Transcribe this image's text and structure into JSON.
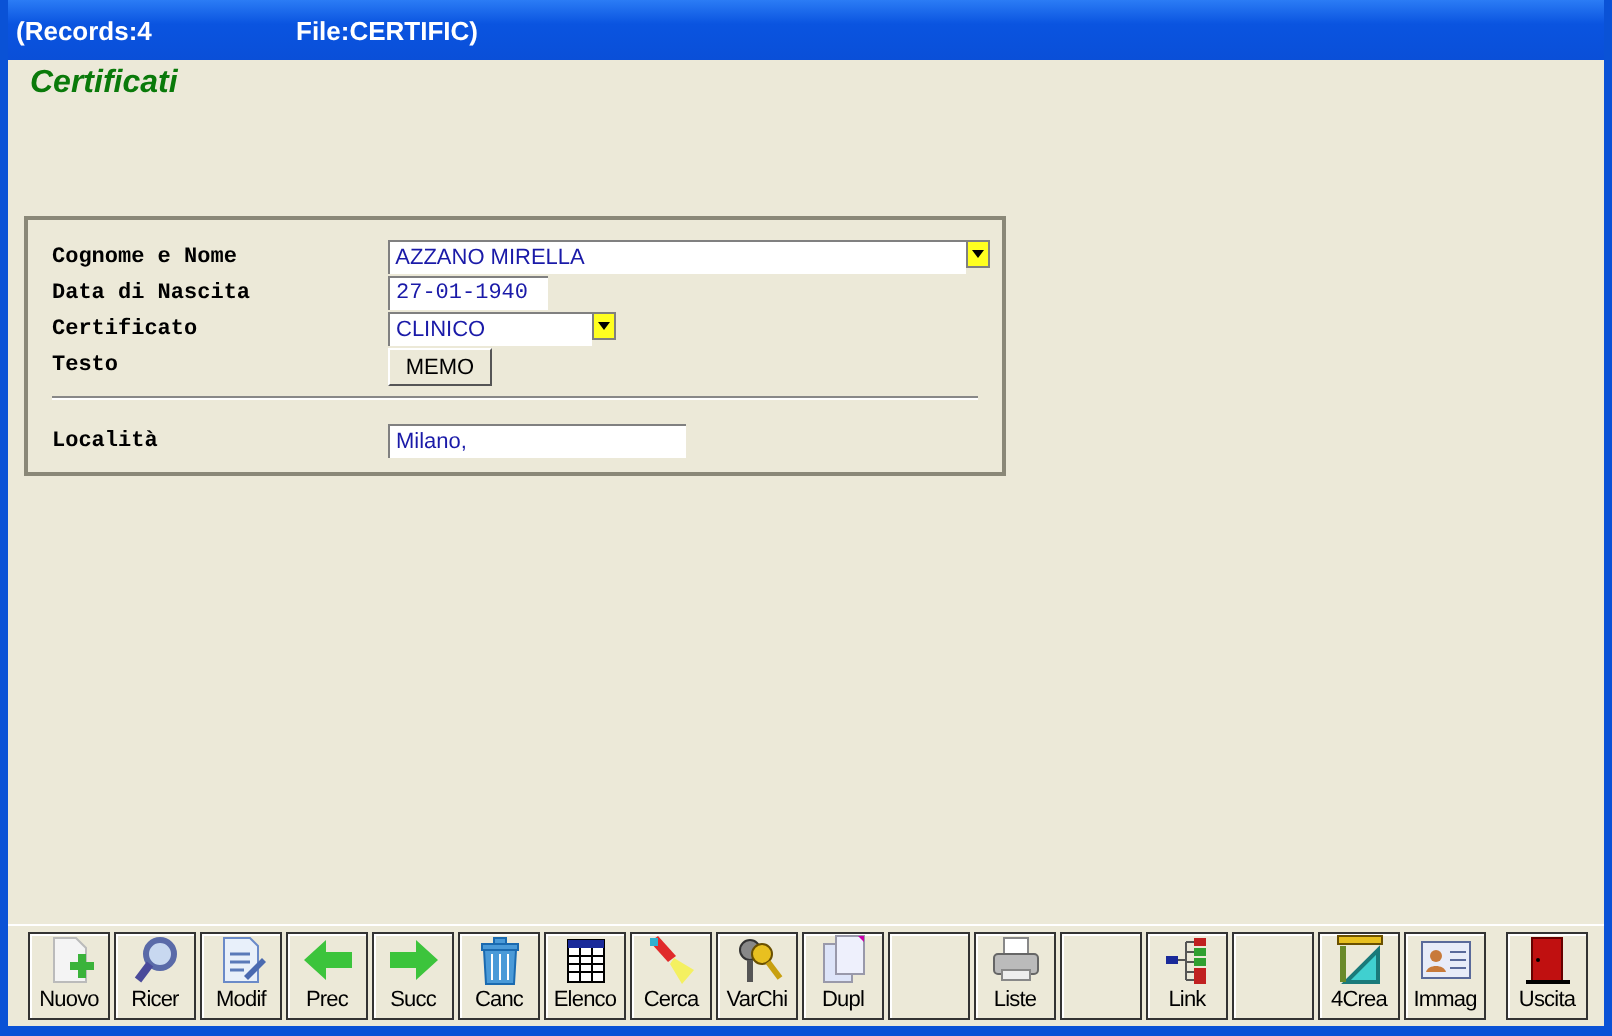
{
  "window": {
    "records": "(Records:4",
    "file": "File:CERTIFIC)"
  },
  "form_title": "Certificati",
  "fields": [
    {
      "label": "Cognome e Nome",
      "kind": "combo",
      "value": "AZZANO MIRELLA"
    },
    {
      "label": "Data di Nascita",
      "kind": "text",
      "value": "27-01-1940"
    },
    {
      "label": "Certificato",
      "kind": "combo",
      "value": "CLINICO"
    },
    {
      "label": "Testo",
      "kind": "button",
      "value": "MEMO"
    }
  ],
  "location": {
    "label": "Località",
    "value": "Milano,"
  },
  "toolbar": [
    {
      "kind": "new",
      "label": "Nuovo"
    },
    {
      "kind": "search",
      "label": "Ricer"
    },
    {
      "kind": "edit",
      "label": "Modif"
    },
    {
      "kind": "prev",
      "label": "Prec"
    },
    {
      "kind": "next",
      "label": "Succ"
    },
    {
      "kind": "delete",
      "label": "Canc"
    },
    {
      "kind": "list",
      "label": "Elenco"
    },
    {
      "kind": "find",
      "label": "Cerca"
    },
    {
      "kind": "keys",
      "label": "VarChi"
    },
    {
      "kind": "copy",
      "label": "Dupl"
    },
    {
      "kind": "blank"
    },
    {
      "kind": "print",
      "label": "Liste"
    },
    {
      "kind": "blank"
    },
    {
      "kind": "link",
      "label": "Link"
    },
    {
      "kind": "blank"
    },
    {
      "kind": "create",
      "label": "4Crea"
    },
    {
      "kind": "image",
      "label": "Immag"
    },
    {
      "kind": "exit",
      "label": "Uscita"
    }
  ]
}
